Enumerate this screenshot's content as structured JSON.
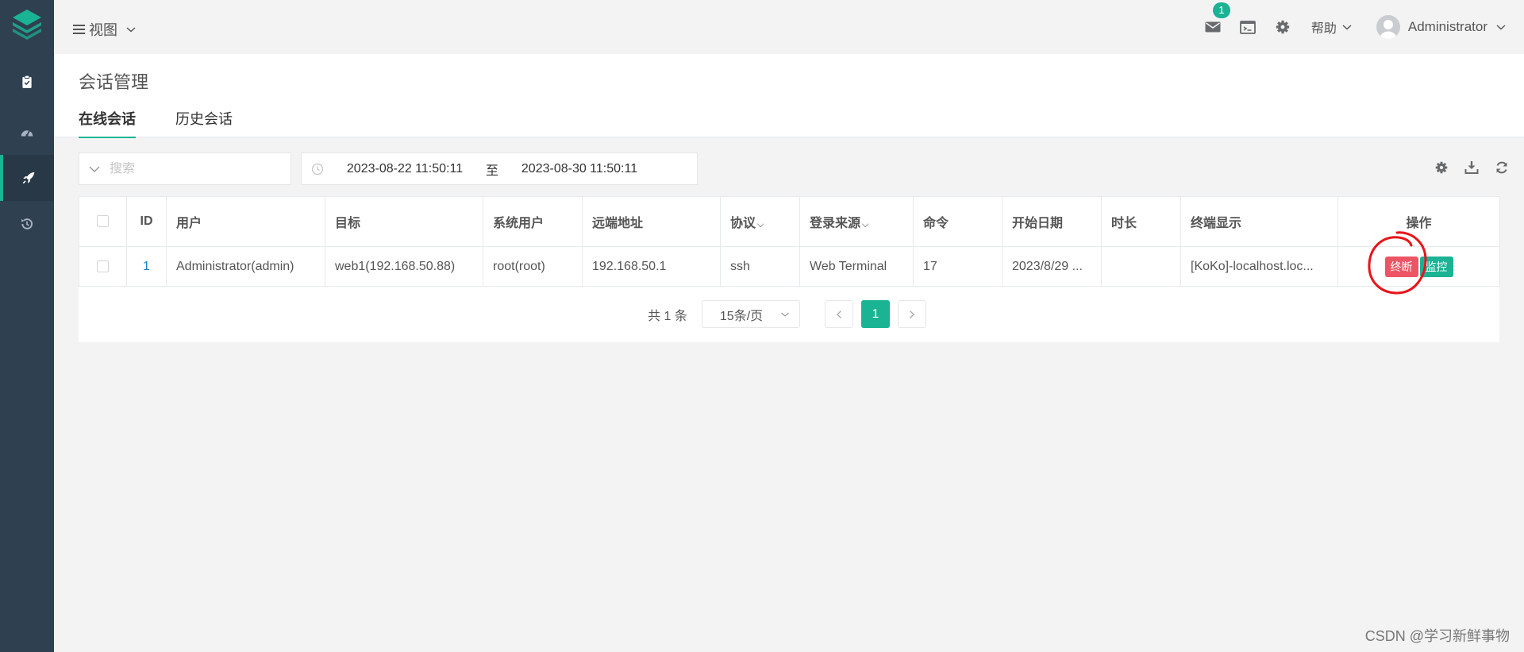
{
  "header": {
    "view_label": "视图",
    "notification_count": "1",
    "help_label": "帮助",
    "user_name": "Administrator"
  },
  "page": {
    "title": "会话管理",
    "tabs": [
      {
        "label": "在线会话",
        "active": true
      },
      {
        "label": "历史会话",
        "active": false
      }
    ]
  },
  "toolbar": {
    "search_placeholder": "搜索",
    "date_from": "2023-08-22 11:50:11",
    "date_to_label": "至",
    "date_to": "2023-08-30 11:50:11"
  },
  "table": {
    "columns": [
      "ID",
      "用户",
      "目标",
      "系统用户",
      "远端地址",
      "协议",
      "登录来源",
      "命令",
      "开始日期",
      "时长",
      "终端显示",
      "操作"
    ],
    "rows": [
      {
        "id": "1",
        "user": "Administrator(admin)",
        "target": "web1(192.168.50.88)",
        "system_user": "root(root)",
        "remote_addr": "192.168.50.1",
        "protocol": "ssh",
        "login_from": "Web Terminal",
        "command": "17",
        "date_start": "2023/8/29 ...",
        "duration": "",
        "terminal": "[KoKo]-localhost.loc...",
        "actions": {
          "terminate": "终断",
          "monitor": "监控"
        }
      }
    ]
  },
  "pagination": {
    "total_text": "共 1 条",
    "page_size": "15条/页",
    "current_page": "1"
  },
  "watermark": "CSDN @学习新鲜事物",
  "colors": {
    "sidebar": "#2f4050",
    "accent": "#1ab394",
    "danger": "#ed5565",
    "annotation": "#e8141a"
  }
}
